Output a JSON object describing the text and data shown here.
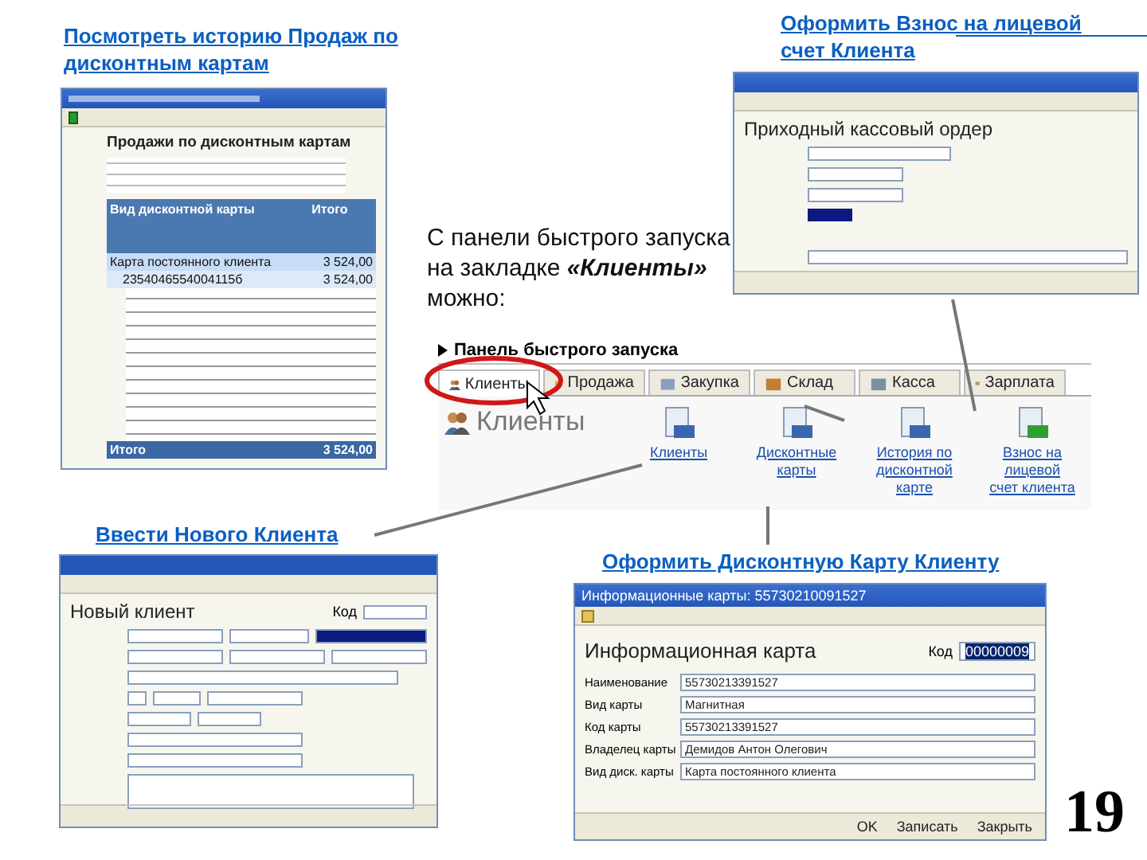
{
  "top_left_link": "Посмотреть историю Продаж по дисконтным картам",
  "sales_window": {
    "heading": "Продажи по дисконтным картам",
    "columns": [
      "Вид дисконтной карты",
      "Итого"
    ],
    "rows": [
      {
        "kind": "group",
        "cells": [
          "Карта постоянного клиента",
          "3 524,00"
        ]
      },
      {
        "kind": "subgroup",
        "cells": [
          "2354046554004115б",
          "3 524,00"
        ]
      }
    ],
    "total": [
      "Итого",
      "3 524,00"
    ]
  },
  "top_right_link": "Оформить Взнос на лицевой счет Клиента",
  "payment_window": {
    "heading": "Приходный кассовый ордер"
  },
  "note": "С панели быстрого запуска на закладке **«Клиенты»** можно:",
  "quick_panel": {
    "title": "Панель быстрого запуска",
    "tabs": [
      {
        "label": "Клиенты",
        "selected": true
      },
      {
        "label": "Продажа",
        "selected": false
      },
      {
        "label": "Закупка",
        "selected": false
      },
      {
        "label": "Склад",
        "selected": false
      },
      {
        "label": "Касса",
        "selected": false
      },
      {
        "label": "Зарплата",
        "selected": false
      }
    ],
    "section": "Клиенты",
    "actions": [
      "Клиенты",
      "Дисконтные карты",
      "История по дисконтной карте",
      "Взнос на лицевой счет клиента"
    ]
  },
  "client_link": "Ввести Нового Клиента",
  "client_window": {
    "heading": "Новый клиент",
    "code_label": "Код"
  },
  "card_link": "Оформить Дисконтную Карту Клиенту",
  "card_window": {
    "title": "Информационные карты: 55730210091527",
    "heading": "Информационная карта",
    "code_label": "Код",
    "code": "00000009",
    "fields": [
      {
        "label": "Наименование",
        "value": "55730213391527"
      },
      {
        "label": "Вид карты",
        "value": "Магнитная"
      },
      {
        "label": "Код карты",
        "value": "55730213391527"
      },
      {
        "label": "Владелец карты",
        "value": "Демидов Антон Олегович"
      },
      {
        "label": "Вид диск. карты",
        "value": "Карта постоянного клиента"
      }
    ],
    "buttons": [
      "OK",
      "Записать",
      "Закрыть"
    ]
  },
  "page_number": "19"
}
